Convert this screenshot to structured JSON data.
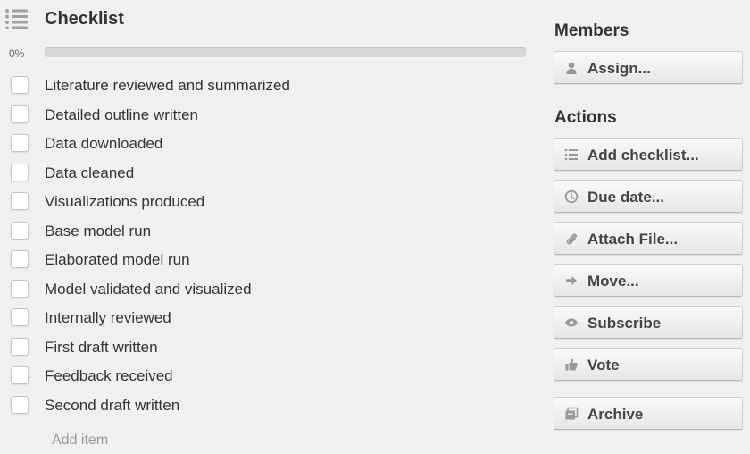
{
  "checklist": {
    "title": "Checklist",
    "progress_label": "0%",
    "progress_fraction": 0,
    "items": [
      {
        "label": "Literature reviewed and summarized",
        "checked": false
      },
      {
        "label": "Detailed outline written",
        "checked": false
      },
      {
        "label": "Data downloaded",
        "checked": false
      },
      {
        "label": "Data cleaned",
        "checked": false
      },
      {
        "label": "Visualizations produced",
        "checked": false
      },
      {
        "label": "Base model run",
        "checked": false
      },
      {
        "label": "Elaborated model run",
        "checked": false
      },
      {
        "label": "Model validated and visualized",
        "checked": false
      },
      {
        "label": "Internally reviewed",
        "checked": false
      },
      {
        "label": "First draft written",
        "checked": false
      },
      {
        "label": "Feedback received",
        "checked": false
      },
      {
        "label": "Second draft written",
        "checked": false
      }
    ],
    "add_item_label": "Add item"
  },
  "members": {
    "title": "Members",
    "assign_label": "Assign..."
  },
  "actions": {
    "title": "Actions",
    "add_checklist_label": "Add checklist...",
    "due_date_label": "Due date...",
    "attach_file_label": "Attach File...",
    "move_label": "Move...",
    "subscribe_label": "Subscribe",
    "vote_label": "Vote",
    "archive_label": "Archive"
  },
  "colors": {
    "background": "#f0f0f0",
    "icon": "#999999",
    "text": "#333333"
  }
}
